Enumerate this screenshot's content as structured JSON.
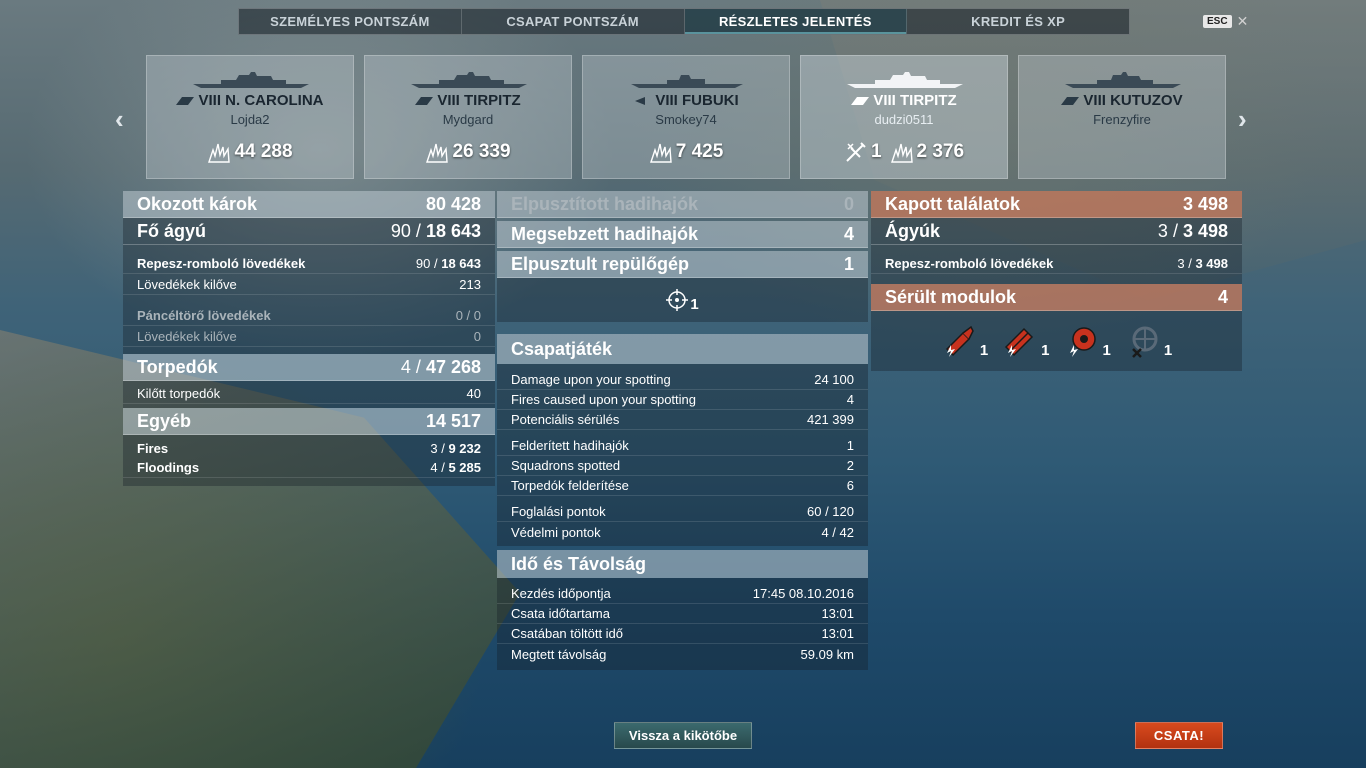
{
  "tabs": [
    {
      "label": "SZEMÉLYES PONTSZÁM",
      "active": false
    },
    {
      "label": "CSAPAT PONTSZÁM",
      "active": false
    },
    {
      "label": "RÉSZLETES JELENTÉS",
      "active": true
    },
    {
      "label": "KREDIT ÉS XP",
      "active": false
    }
  ],
  "esc_label": "ESC",
  "close_icon": "close-icon",
  "ships": [
    {
      "tier_name": "VIII N. CAROLINA",
      "player": "Lojda2",
      "damage": "44 288",
      "planes": "",
      "icon": "battleship-icon"
    },
    {
      "tier_name": "VIII TIRPITZ",
      "player": "Mydgard",
      "damage": "26 339",
      "planes": "",
      "icon": "battleship-icon"
    },
    {
      "tier_name": "VIII FUBUKI",
      "player": "Smokey74",
      "damage": "7 425",
      "planes": "",
      "icon": "destroyer-icon"
    },
    {
      "tier_name": "VIII TIRPITZ",
      "player": "dudzi0511",
      "damage": "2 376",
      "planes": "1",
      "icon": "battleship-icon"
    },
    {
      "tier_name": "VIII KUTUZOV",
      "player": "Frenzyfire",
      "damage": "",
      "planes": "",
      "icon": "cruiser-icon"
    }
  ],
  "left": {
    "damage_caused": {
      "label": "Okozott károk",
      "value": "80 428"
    },
    "main_battery": {
      "label": "Fő ágyú",
      "hits": "90",
      "sep": " / ",
      "value": "18 643"
    },
    "he_shells": {
      "label": "Repesz-romboló lövedékek",
      "hits": "90",
      "sep": " / ",
      "value": "18 643"
    },
    "he_fired": {
      "label": "Lövedékek kilőve",
      "value": "213"
    },
    "ap_shells": {
      "label": "Páncéltörő lövedékek",
      "value": "0 / 0"
    },
    "ap_fired": {
      "label": "Lövedékek kilőve",
      "value": "0"
    },
    "torpedoes": {
      "label": "Torpedók",
      "hits": "4",
      "sep": " / ",
      "value": "47 268"
    },
    "torp_launched": {
      "label": "Kilőtt torpedók",
      "value": "40"
    },
    "other": {
      "label": "Egyéb",
      "value": "14 517"
    },
    "fires": {
      "label": "Fires",
      "hits": "3",
      "sep": " / ",
      "value": "9 232"
    },
    "floodings": {
      "label": "Floodings",
      "hits": "4",
      "sep": " / ",
      "value": "5 285"
    }
  },
  "middle": {
    "destroyed_ships": {
      "label": "Elpusztított hadihajók",
      "value": "0"
    },
    "damaged_ships": {
      "label": "Megsebzett hadihajók",
      "value": "4"
    },
    "planes_destroyed": {
      "label": "Elpusztult repülőgép",
      "value": "1"
    },
    "crosshair_count": "1",
    "teamplay_title": "Csapatjáték",
    "teamplay_rows": [
      {
        "label": "Damage upon your spotting",
        "value": "24 100"
      },
      {
        "label": "Fires caused upon your spotting",
        "value": "4"
      },
      {
        "label": "Potenciális sérülés",
        "value": "421 399"
      },
      {
        "label": "Felderített hadihajók",
        "value": "1"
      },
      {
        "label": "Squadrons spotted",
        "value": "2"
      },
      {
        "label": "Torpedók felderítése",
        "value": "6"
      },
      {
        "label": "Foglalási pontok",
        "value": "60 / 120"
      },
      {
        "label": "Védelmi pontok",
        "value": "4 / 42"
      }
    ],
    "time_title": "Idő és Távolság",
    "time_rows": [
      {
        "label": "Kezdés időpontja",
        "value": "17:45  08.10.2016"
      },
      {
        "label": "Csata időtartama",
        "value": "13:01"
      },
      {
        "label": "Csatában töltött idő",
        "value": "13:01"
      },
      {
        "label": "Megtett távolság",
        "value": "59.09 km"
      }
    ]
  },
  "right": {
    "hits_received": {
      "label": "Kapott találatok",
      "value": "3 498"
    },
    "guns": {
      "label": "Ágyúk",
      "hits": "3",
      "sep": " / ",
      "value": "3 498"
    },
    "he_shells": {
      "label": "Repesz-romboló lövedékek",
      "hits": "3",
      "sep": " / ",
      "value": "3 498"
    },
    "damaged_modules": {
      "label": "Sérült modulok",
      "value": "4"
    },
    "modules": [
      {
        "icon": "main-battery-module-icon",
        "count": "1"
      },
      {
        "icon": "torpedo-tubes-module-icon",
        "count": "1"
      },
      {
        "icon": "engine-module-icon",
        "count": "1"
      },
      {
        "icon": "steering-module-icon",
        "count": "1"
      }
    ]
  },
  "buttons": {
    "port": "Vissza a kikötőbe",
    "battle": "CSATA!"
  }
}
